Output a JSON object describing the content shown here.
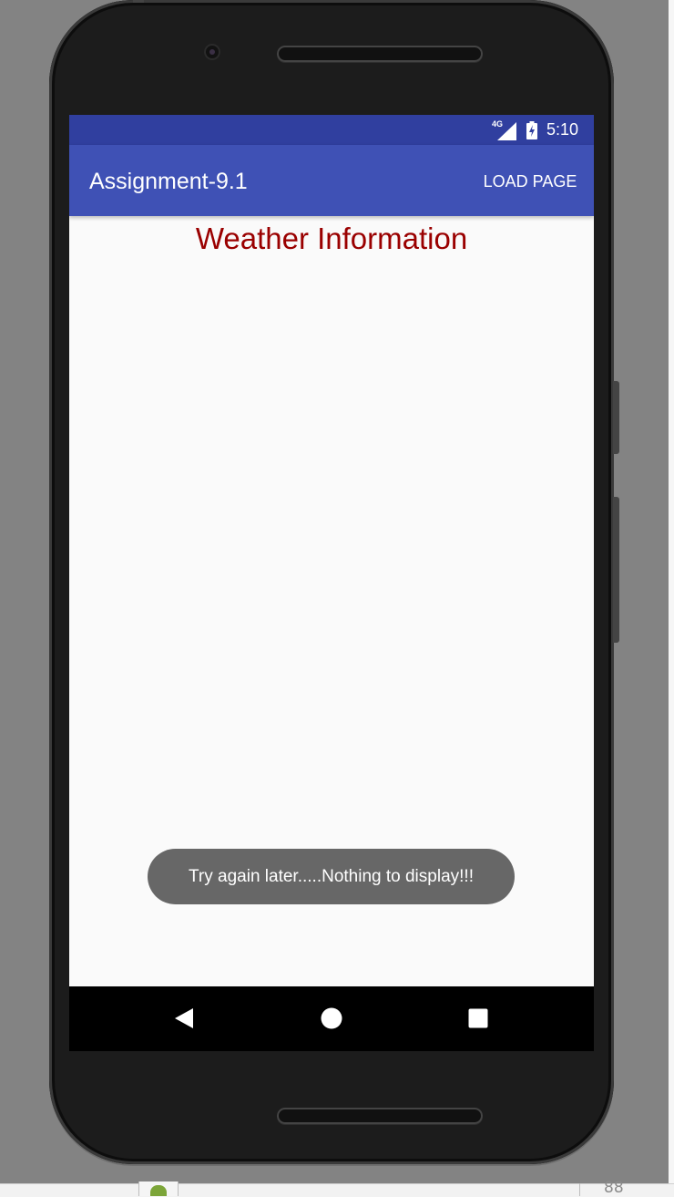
{
  "status_bar": {
    "network_label": "4G",
    "signal_icon": "cellular-signal-icon",
    "battery_icon": "battery-charging-icon",
    "time": "5:10",
    "color": "#303f9f"
  },
  "app_bar": {
    "title": "Assignment-9.1",
    "action_label": "LOAD PAGE",
    "color": "#3f51b5"
  },
  "content": {
    "heading": "Weather Information",
    "heading_color": "#9a0000"
  },
  "toast": {
    "message": "Try again later.....Nothing to display!!!"
  },
  "nav_bar": {
    "back_icon": "back-triangle-icon",
    "home_icon": "home-circle-icon",
    "recents_icon": "recents-square-icon"
  },
  "host_window": {
    "line_number": "88",
    "droid_icon": "android-icon"
  }
}
